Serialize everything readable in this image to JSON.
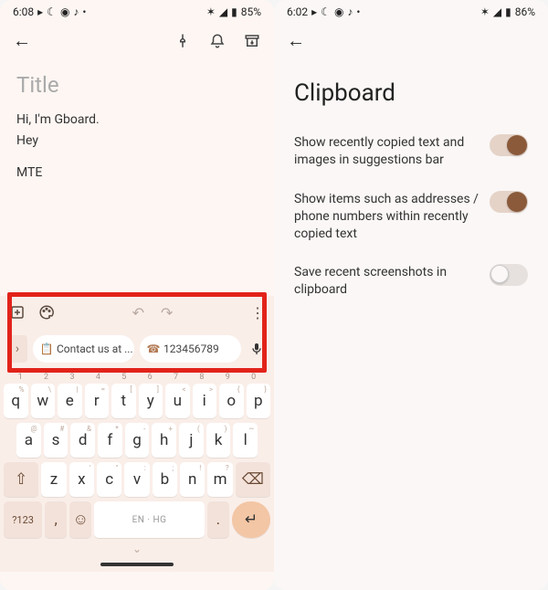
{
  "left": {
    "status": {
      "time": "6:08",
      "battery": "85%"
    },
    "note": {
      "title_placeholder": "Title",
      "line1": "Hi, I'm Gboard.",
      "line2": "Hey",
      "line3": "MTE"
    },
    "suggestions": {
      "chip1": "Contact us at ...",
      "chip2": "123456789"
    },
    "symbols_key": "?123",
    "space_label": "EN · HG",
    "numrow": [
      "1",
      "2",
      "3",
      "4",
      "5",
      "6",
      "7",
      "8",
      "9",
      "0"
    ],
    "row1": [
      "q",
      "w",
      "e",
      "r",
      "t",
      "y",
      "u",
      "i",
      "o",
      "p"
    ],
    "row1_hints": [
      "%",
      "\\",
      "|",
      "=",
      "[",
      "]",
      "<",
      ">",
      "{",
      "}"
    ],
    "row2": [
      "a",
      "s",
      "d",
      "f",
      "g",
      "h",
      "j",
      "k",
      "l"
    ],
    "row2_hints": [
      "@",
      "#",
      "&",
      "*",
      "-",
      "+",
      "(",
      ")",
      "~"
    ],
    "row3": [
      "z",
      "x",
      "c",
      "v",
      "b",
      "n",
      "m"
    ],
    "row3_hints": [
      "",
      "'",
      "\"",
      ":",
      ";",
      "!",
      "?"
    ]
  },
  "right": {
    "status": {
      "time": "6:02",
      "battery": "86%"
    },
    "title": "Clipboard",
    "opt1": "Show recently copied text and images in suggestions bar",
    "opt2": "Show items such as addresses / phone numbers within recently copied text",
    "opt3": "Save recent screenshots in clipboard"
  }
}
